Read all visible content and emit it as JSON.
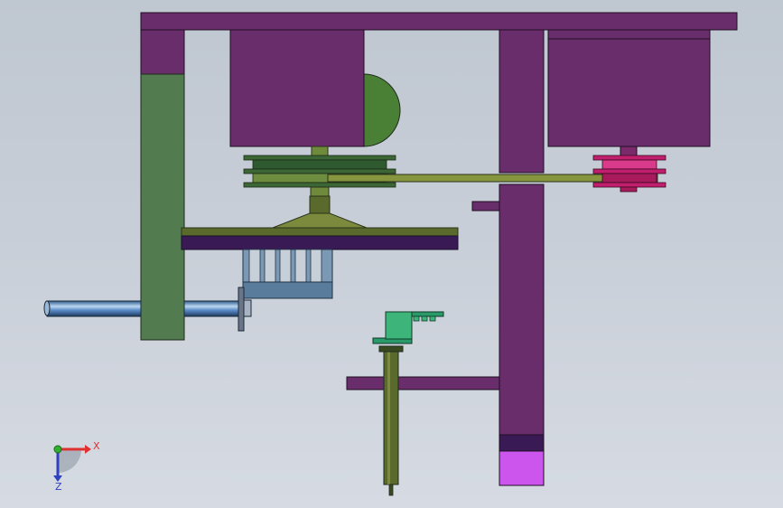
{
  "colors": {
    "background_top": "#bfc7d1",
    "background_bottom": "#d6dbe3",
    "purple": "#6a2d6c",
    "purple_dark": "#3a1a55",
    "magenta_tint": "#cc55ee",
    "green": "#537b50",
    "green_bright": "#4a7f36",
    "olive": "#7c8a3e",
    "olive_dark": "#5a6a2c",
    "belt": "#86963f",
    "pulley_pink": "#c21e6e",
    "blue_gray": "#5a7c9c",
    "bracket_green": "#3db57a",
    "shaft_blue": "#5b8cc8",
    "axis_x": "#e03030",
    "axis_y": "#30b030",
    "axis_z": "#3040c0"
  },
  "triad": {
    "x_label": "X",
    "z_label": "Z"
  }
}
